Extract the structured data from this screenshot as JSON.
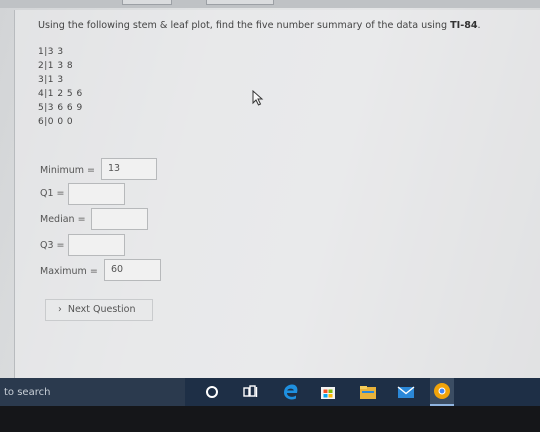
{
  "question": {
    "text": "Using the following stem & leaf plot, find the five number summary of the data using ",
    "bold": "TI-84",
    "suffix": "."
  },
  "stem_leaf": [
    "1|3 3",
    "2|1 3 8",
    "3|1 3",
    "4|1 2 5 6",
    "5|3 6 6 9",
    "6|0 0 0"
  ],
  "fields": [
    {
      "label": "Minimum =",
      "value": "13"
    },
    {
      "label": "Q1 =",
      "value": ""
    },
    {
      "label": "Median =",
      "value": ""
    },
    {
      "label": "Q3 =",
      "value": ""
    },
    {
      "label": "Maximum =",
      "value": "60"
    }
  ],
  "next_button": {
    "label": "Next Question"
  },
  "taskbar": {
    "search_text": "to search"
  },
  "colors": {
    "taskbar": "#1e2f46",
    "edge_blue": "#1e90e0",
    "store_blue": "#2b88d8",
    "chrome_orange": "#f0a30a"
  }
}
